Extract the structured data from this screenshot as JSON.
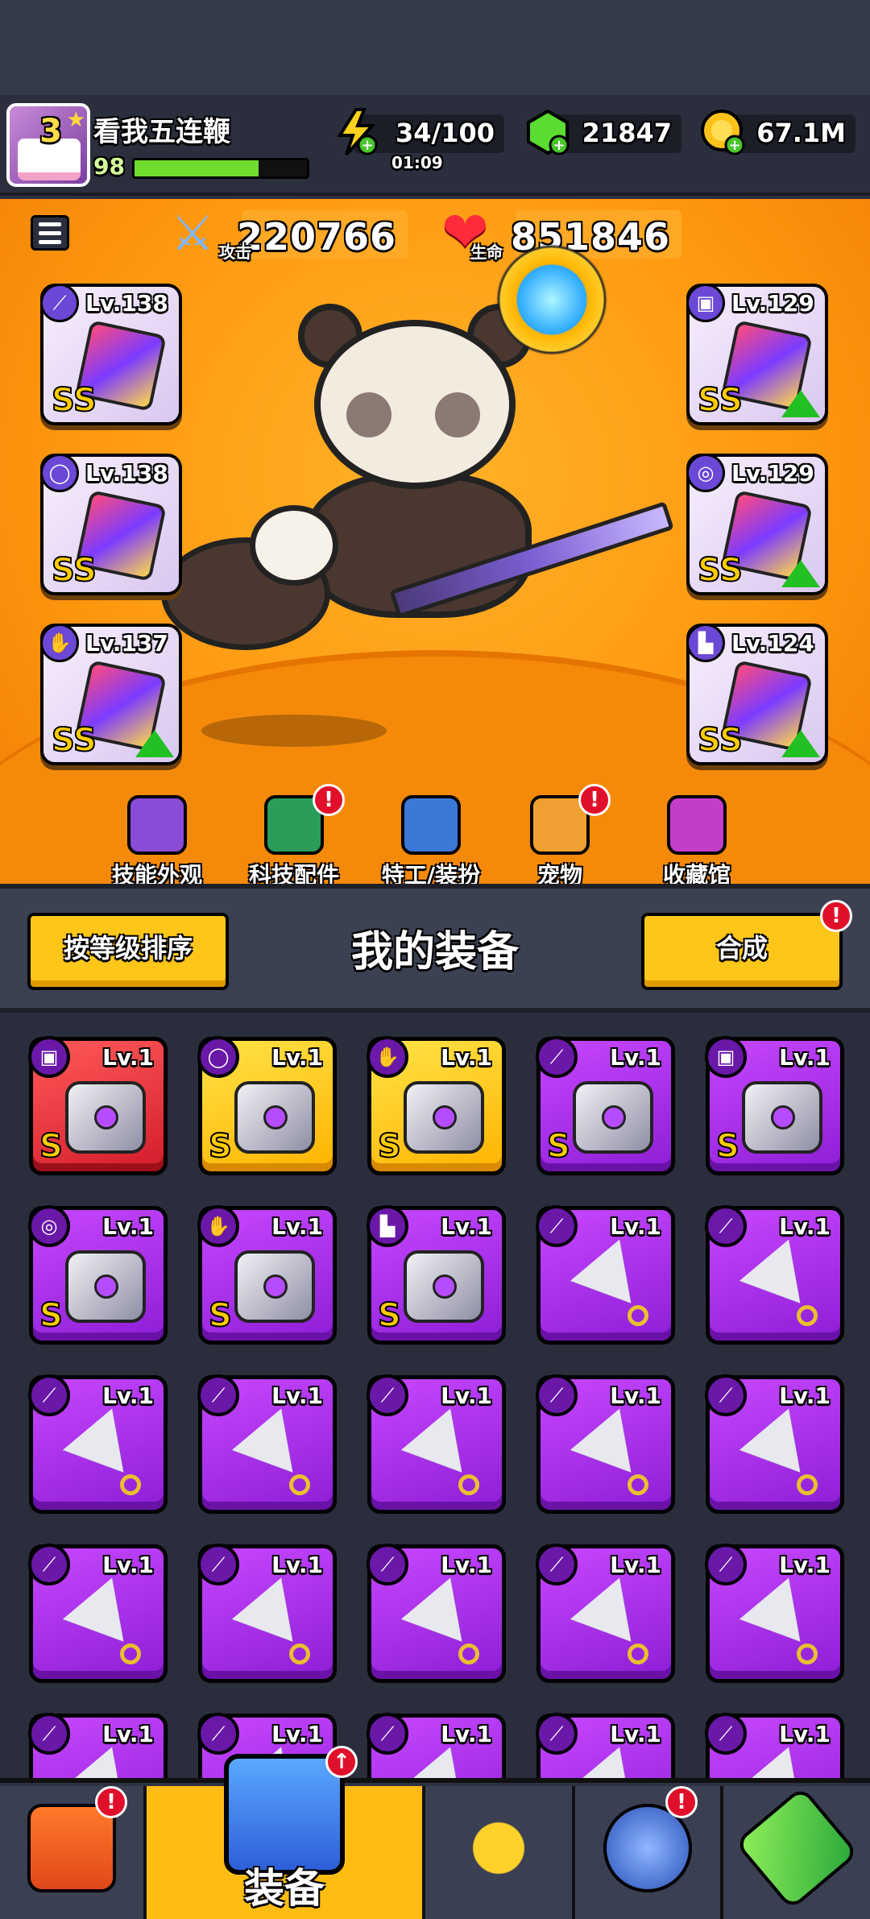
{
  "player": {
    "name": "看我五连鞭",
    "level": "98",
    "avatar_rank": "3",
    "xp_fraction": 0.72
  },
  "resources": {
    "energy": "34/100",
    "energy_timer": "01:09",
    "gems": "21847",
    "gold": "67.1M"
  },
  "stats": {
    "attack_value": "220766",
    "attack_label": "攻击",
    "hp_value": "851846",
    "hp_label": "生命"
  },
  "equipped": {
    "left": [
      {
        "level": "Lv.138",
        "grade": "SS",
        "slot_icon": "weapon-icon",
        "upgrade": false
      },
      {
        "level": "Lv.138",
        "grade": "SS",
        "slot_icon": "necklace-icon",
        "upgrade": false
      },
      {
        "level": "Lv.137",
        "grade": "SS",
        "slot_icon": "glove-icon",
        "upgrade": true
      }
    ],
    "right": [
      {
        "level": "Lv.129",
        "grade": "SS",
        "slot_icon": "armor-icon",
        "upgrade": true
      },
      {
        "level": "Lv.129",
        "grade": "SS",
        "slot_icon": "belt-icon",
        "upgrade": true
      },
      {
        "level": "Lv.124",
        "grade": "SS",
        "slot_icon": "boots-icon",
        "upgrade": true
      }
    ]
  },
  "categories": [
    {
      "label": "技能外观",
      "badge": false,
      "color": "#8a4bd6"
    },
    {
      "label": "科技配件",
      "badge": true,
      "color": "#2a9d5a"
    },
    {
      "label": "特工/装扮",
      "badge": false,
      "color": "#3c78d8"
    },
    {
      "label": "宠物",
      "badge": true,
      "color": "#f0a030"
    },
    {
      "label": "收藏馆",
      "badge": false,
      "color": "#c43dc9"
    }
  ],
  "equipment_bar": {
    "sort_label": "按等级排序",
    "title": "我的装备",
    "merge_label": "合成",
    "merge_badge": "!"
  },
  "inventory_rows": [
    [
      {
        "level": "Lv.1",
        "grade": "S",
        "rarity": "red",
        "kind": "armor"
      },
      {
        "level": "Lv.1",
        "grade": "S",
        "rarity": "gold",
        "kind": "necklace"
      },
      {
        "level": "Lv.1",
        "grade": "S",
        "rarity": "gold",
        "kind": "glove"
      },
      {
        "level": "Lv.1",
        "grade": "S",
        "rarity": "purple",
        "kind": "weapon"
      },
      {
        "level": "Lv.1",
        "grade": "S",
        "rarity": "purple",
        "kind": "armor"
      }
    ],
    [
      {
        "level": "Lv.1",
        "grade": "S",
        "rarity": "purple",
        "kind": "belt"
      },
      {
        "level": "Lv.1",
        "grade": "S",
        "rarity": "purple",
        "kind": "glove"
      },
      {
        "level": "Lv.1",
        "grade": "S",
        "rarity": "purple",
        "kind": "boots"
      },
      {
        "level": "Lv.1",
        "grade": "",
        "rarity": "purple",
        "kind": "kunai"
      },
      {
        "level": "Lv.1",
        "grade": "",
        "rarity": "purple",
        "kind": "kunai"
      }
    ],
    [
      {
        "level": "Lv.1",
        "grade": "",
        "rarity": "purple",
        "kind": "kunai"
      },
      {
        "level": "Lv.1",
        "grade": "",
        "rarity": "purple",
        "kind": "kunai"
      },
      {
        "level": "Lv.1",
        "grade": "",
        "rarity": "purple",
        "kind": "kunai"
      },
      {
        "level": "Lv.1",
        "grade": "",
        "rarity": "purple",
        "kind": "kunai"
      },
      {
        "level": "Lv.1",
        "grade": "",
        "rarity": "purple",
        "kind": "kunai"
      }
    ],
    [
      {
        "level": "Lv.1",
        "grade": "",
        "rarity": "purple",
        "kind": "kunai"
      },
      {
        "level": "Lv.1",
        "grade": "",
        "rarity": "purple",
        "kind": "kunai"
      },
      {
        "level": "Lv.1",
        "grade": "",
        "rarity": "purple",
        "kind": "kunai"
      },
      {
        "level": "Lv.1",
        "grade": "",
        "rarity": "purple",
        "kind": "kunai"
      },
      {
        "level": "Lv.1",
        "grade": "",
        "rarity": "purple",
        "kind": "kunai"
      }
    ],
    [
      {
        "level": "Lv.1",
        "grade": "",
        "rarity": "purple",
        "kind": "kunai"
      },
      {
        "level": "Lv.1",
        "grade": "",
        "rarity": "purple",
        "kind": "kunai"
      },
      {
        "level": "Lv.1",
        "grade": "",
        "rarity": "purple",
        "kind": "kunai"
      },
      {
        "level": "Lv.1",
        "grade": "",
        "rarity": "purple",
        "kind": "kunai"
      },
      {
        "level": "Lv.1",
        "grade": "",
        "rarity": "purple",
        "kind": "kunai"
      }
    ]
  ],
  "bottom_tabs": {
    "equip_label": "装备",
    "items": [
      {
        "name": "shop-icon",
        "badge": true
      },
      {
        "name": "equip-icon",
        "badge": true
      },
      {
        "name": "battle-icon",
        "badge": false
      },
      {
        "name": "planet-icon",
        "badge": true
      },
      {
        "name": "dna-icon",
        "badge": false
      }
    ]
  },
  "colors": {
    "arena_orange": "#ff9a10",
    "purple_item": "#b93cf0",
    "gold_item": "#ffc61a",
    "red_item": "#e22a3a",
    "upgrade_green": "#22c023",
    "badge_red": "#e0102a"
  }
}
